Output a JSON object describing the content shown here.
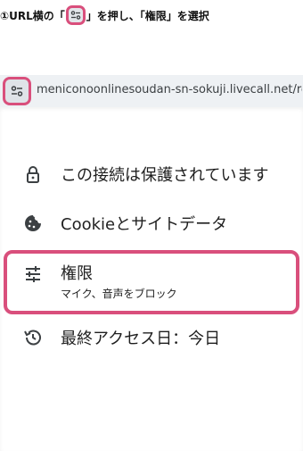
{
  "instruction": {
    "prefix": "①URL横の「",
    "suffix": "」を押し、「権限」を選択"
  },
  "address_bar": {
    "url": "meniconoonlinesoudan-sn-sokuji.livecall.net/ro",
    "site_info_icon": "tune-icon"
  },
  "menu": {
    "items": [
      {
        "icon": "lock-icon",
        "label": "この接続は保護されています"
      },
      {
        "icon": "cookie-icon",
        "label": "Cookieとサイトデータ"
      },
      {
        "icon": "tune-icon",
        "label": "権限",
        "sublabel": "マイク、音声をブロック"
      },
      {
        "icon": "history-icon",
        "label": "最終アクセス日：今日"
      }
    ]
  },
  "colors": {
    "highlight": "#d94f7c",
    "address_bar_bg": "#eef1f4"
  }
}
